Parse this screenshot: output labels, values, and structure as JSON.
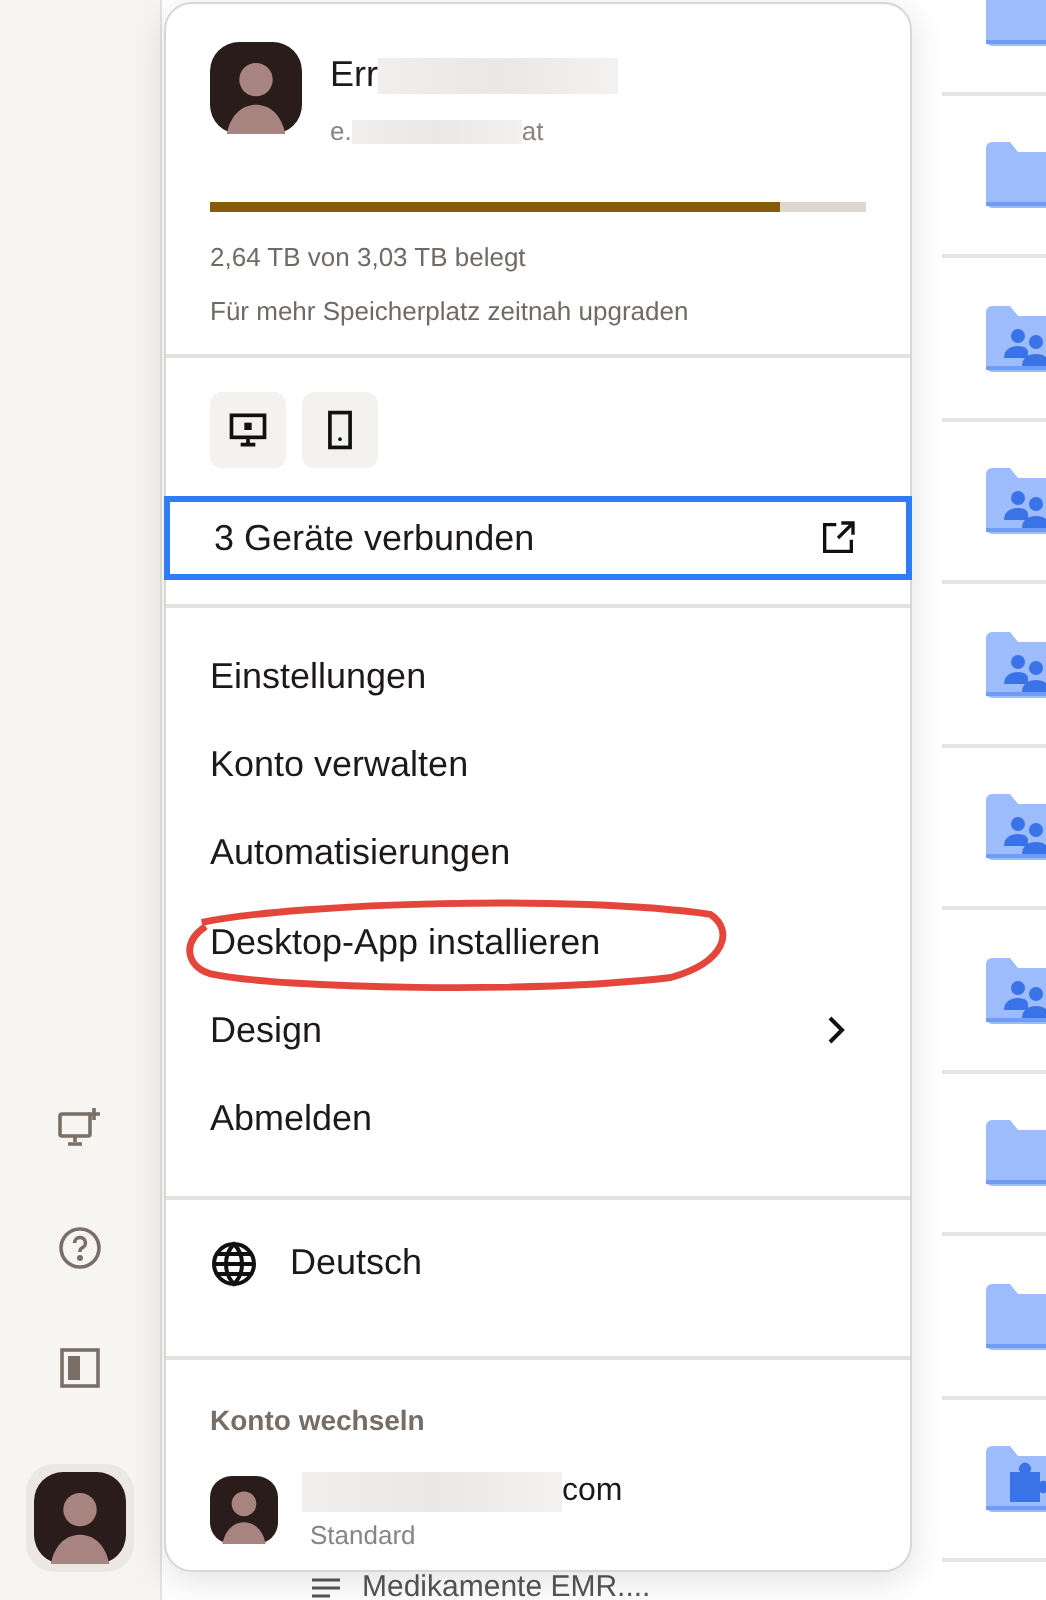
{
  "account": {
    "name": "Err",
    "email_start": "e.",
    "email_end": "at",
    "storage": {
      "level": 0.87,
      "text": "2,64 TB von 3,03 TB belegt",
      "hint": "Für mehr Speicherplatz zeitnah upgraden"
    }
  },
  "devices": {
    "label": "3 Geräte verbunden",
    "focused": true
  },
  "menu": [
    {
      "label": "Einstellungen",
      "submenu": false,
      "circled": false
    },
    {
      "label": "Konto verwalten",
      "submenu": false,
      "circled": false
    },
    {
      "label": "Automatisierungen",
      "submenu": false,
      "circled": false
    },
    {
      "label": "Desktop-App installieren",
      "submenu": false,
      "circled": true
    },
    {
      "label": "Design",
      "submenu": true,
      "circled": false
    },
    {
      "label": "Abmelden",
      "submenu": false,
      "circled": false
    }
  ],
  "language": "Deutsch",
  "switch_account": {
    "title": "Konto wechseln",
    "accounts": [
      {
        "email_end": "com",
        "role": "Standard"
      }
    ]
  },
  "file_peek": "Medikamente EMR....",
  "files": [
    {
      "kind": "folder"
    },
    {
      "kind": "folder"
    },
    {
      "kind": "shared"
    },
    {
      "kind": "shared"
    },
    {
      "kind": "shared"
    },
    {
      "kind": "shared"
    },
    {
      "kind": "shared"
    },
    {
      "kind": "folder"
    },
    {
      "kind": "folder"
    },
    {
      "kind": "puzzle"
    }
  ]
}
